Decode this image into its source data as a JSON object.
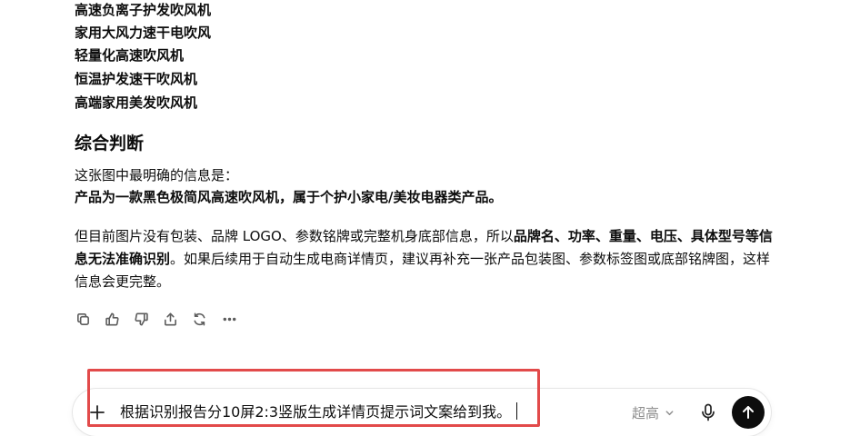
{
  "response": {
    "product_names": [
      "高速负离子护发吹风机",
      "家用大风力速干电吹风",
      "轻量化高速吹风机",
      "恒温护发速干吹风机",
      "高端家用美发吹风机"
    ],
    "section_title": "综合判断",
    "para1_line1": "这张图中最明确的信息是：",
    "para1_line2": "产品为一款黑色极简风高速吹风机，属于个护小家电/美妆电器类产品。",
    "para2_part1": "但目前图片没有包装、品牌 LOGO、参数铭牌或完整机身底部信息，所以",
    "para2_bold": "品牌名、功率、重量、电压、具体型号等信息无法准确识别",
    "para2_part2": "。如果后续用于自动生成电商详情页，建议再补充一张产品包装图、参数标签图或底部铭牌图，这样信息会更完整。"
  },
  "actions": {
    "icons": [
      "copy-icon",
      "thumbs-up-icon",
      "thumbs-down-icon",
      "share-icon",
      "regenerate-icon",
      "more-icon"
    ],
    "more_label": "···"
  },
  "composer": {
    "input_value": "根据识别报告分10屏2:3竖版生成详情页提示词文案给到我。",
    "model_label": "超高",
    "send_color": "#0d0d0d"
  },
  "annotation": {
    "highlight_color": "#e24a4a"
  }
}
